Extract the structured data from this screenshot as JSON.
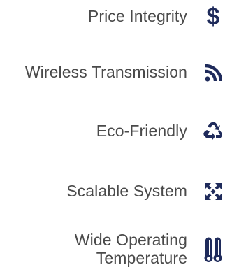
{
  "colors": {
    "text": "#4a4a4a",
    "icon": "#1f2b5b"
  },
  "features": [
    {
      "label": "Price Integrity",
      "icon": "dollar-icon"
    },
    {
      "label": "Wireless Transmission",
      "icon": "rss-icon"
    },
    {
      "label": "Eco-Friendly",
      "icon": "recycle-icon"
    },
    {
      "label": "Scalable System",
      "icon": "expand-icon"
    },
    {
      "label_line1": "Wide Operating",
      "label_line2": "Temperature",
      "icon": "thermometer-icon"
    }
  ]
}
